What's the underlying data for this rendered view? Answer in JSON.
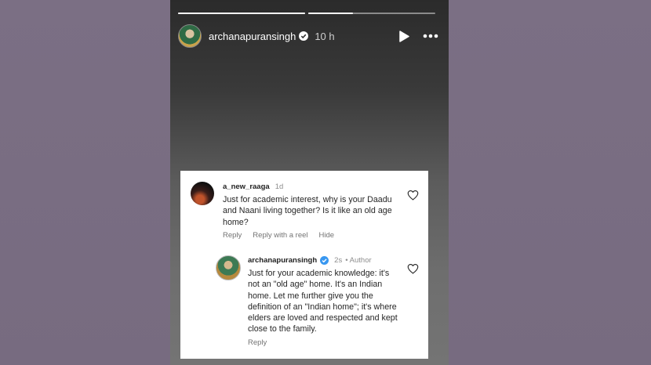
{
  "story": {
    "username": "archanapuransingh",
    "time": "10 h",
    "progress": [
      1.0,
      0.35
    ]
  },
  "comments": [
    {
      "username": "a_new_raaga",
      "age": "1d",
      "text": "Just for academic interest, why is your Daadu and Naani living together? Is it like an old age home?",
      "actions": {
        "reply": "Reply",
        "reply_reel": "Reply with a reel",
        "hide": "Hide"
      }
    },
    {
      "username": "archanapuransingh",
      "age": "2s",
      "author_label": "• Author",
      "text": "Just for your academic knowledge: it's not an \"old age\" home. It's an Indian home. Let me further give you the definition of an \"Indian home\"; it's where elders are loved and respected and kept close to the family.",
      "actions": {
        "reply": "Reply"
      }
    }
  ],
  "colors": {
    "verified": "#3897f0",
    "background": "#7b6f84",
    "card": "#ffffff"
  },
  "icons": [
    "verified-badge-icon",
    "play-icon",
    "more-icon",
    "heart-icon"
  ]
}
